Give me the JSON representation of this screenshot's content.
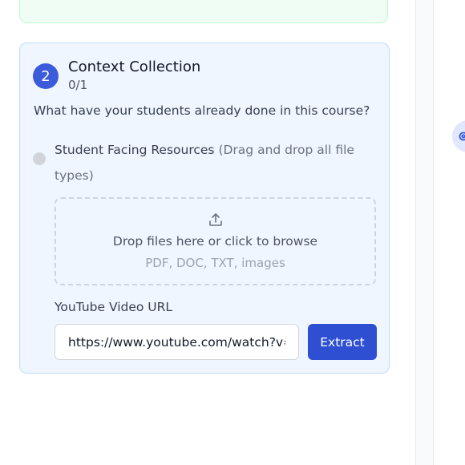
{
  "step": {
    "number": "2",
    "title": "Context Collection",
    "progress": "0/1",
    "question": "What have your students already done in this course?",
    "resource": {
      "label": "Student Facing Resources",
      "hint": "(Drag and drop all file types)"
    },
    "dropzone": {
      "icon": "upload-icon",
      "text": "Drop files here or click to browse",
      "subtext": "PDF, DOC, TXT, images"
    },
    "youtube": {
      "label": "YouTube Video URL",
      "value": "https://www.youtube.com/watch?v=r",
      "button_label": "Extract"
    }
  },
  "colors": {
    "accent": "#3b5bdb",
    "button": "#2e4fd1",
    "card_bg": "#eff6ff",
    "prev_card_bg": "#f0fdf4"
  },
  "side_toggle": {
    "icon": "settings-icon"
  }
}
